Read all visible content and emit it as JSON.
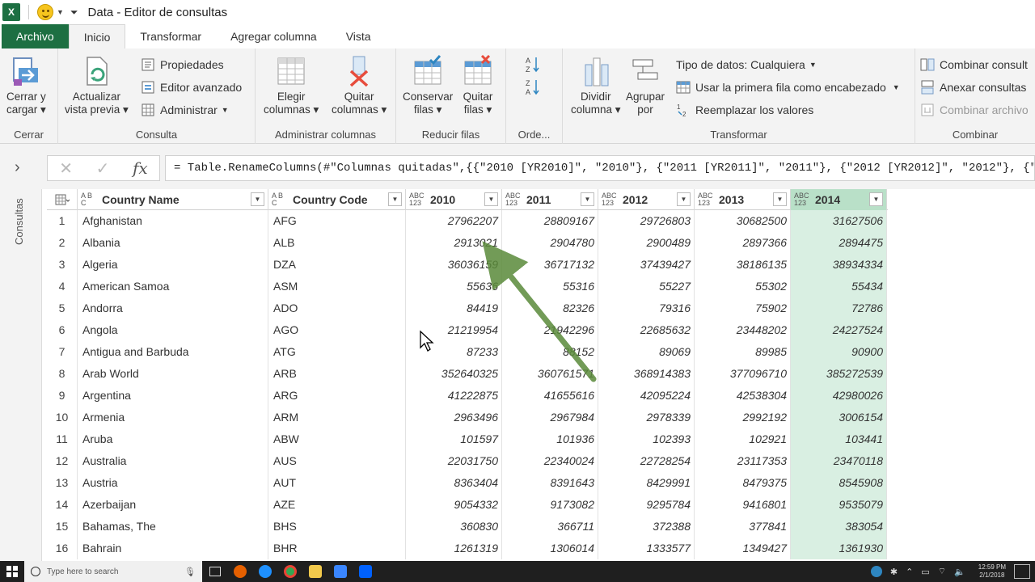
{
  "window": {
    "title": "Data - Editor de consultas"
  },
  "tabs": [
    "Archivo",
    "Inicio",
    "Transformar",
    "Agregar columna",
    "Vista"
  ],
  "ribbon": {
    "cerrar": {
      "btn1": "Cerrar y",
      "btn2": "cargar",
      "label": "Cerrar"
    },
    "consulta": {
      "actualizar1": "Actualizar",
      "actualizar2": "vista previa",
      "propiedades": "Propiedades",
      "editor": "Editor avanzado",
      "administrar": "Administrar",
      "label": "Consulta"
    },
    "columnas": {
      "elegir1": "Elegir",
      "elegir2": "columnas",
      "quitar1": "Quitar",
      "quitar2": "columnas",
      "label": "Administrar columnas"
    },
    "filas": {
      "conservar1": "Conservar",
      "conservar2": "filas",
      "quitar1": "Quitar",
      "quitar2": "filas",
      "label": "Reducir filas"
    },
    "ordenar": {
      "label": "Orde..."
    },
    "transformar": {
      "dividir1": "Dividir",
      "dividir2": "columna",
      "agrupar1": "Agrupar",
      "agrupar2": "por",
      "tipo": "Tipo de datos: Cualquiera",
      "primera": "Usar la primera fila como encabezado",
      "reemplazar": "Reemplazar los valores",
      "label": "Transformar"
    },
    "combinar": {
      "combinar": "Combinar consult",
      "anexar": "Anexar consultas",
      "archivos": "Combinar archivo",
      "label": "Combinar"
    }
  },
  "formula": "= Table.RenameColumns(#\"Columnas quitadas\",{{\"2010 [YR2010]\", \"2010\"}, {\"2011 [YR2011]\", \"2011\"}, {\"2012 [YR2012]\", \"2012\"}, {\"",
  "left_pane": {
    "label": "Consultas"
  },
  "table": {
    "columns": [
      "Country Name",
      "Country Code",
      "2010",
      "2011",
      "2012",
      "2013",
      "2014"
    ],
    "text_type": "A B C",
    "num_type": "ABC 123",
    "rows": [
      [
        "1",
        "Afghanistan",
        "AFG",
        "27962207",
        "28809167",
        "29726803",
        "30682500",
        "31627506"
      ],
      [
        "2",
        "Albania",
        "ALB",
        "2913021",
        "2904780",
        "2900489",
        "2897366",
        "2894475"
      ],
      [
        "3",
        "Algeria",
        "DZA",
        "36036159",
        "36717132",
        "37439427",
        "38186135",
        "38934334"
      ],
      [
        "4",
        "American Samoa",
        "ASM",
        "55636",
        "55316",
        "55227",
        "55302",
        "55434"
      ],
      [
        "5",
        "Andorra",
        "ADO",
        "84419",
        "82326",
        "79316",
        "75902",
        "72786"
      ],
      [
        "6",
        "Angola",
        "AGO",
        "21219954",
        "21942296",
        "22685632",
        "23448202",
        "24227524"
      ],
      [
        "7",
        "Antigua and Barbuda",
        "ATG",
        "87233",
        "88152",
        "89069",
        "89985",
        "90900"
      ],
      [
        "8",
        "Arab World",
        "ARB",
        "352640325",
        "360761571",
        "368914383",
        "377096710",
        "385272539"
      ],
      [
        "9",
        "Argentina",
        "ARG",
        "41222875",
        "41655616",
        "42095224",
        "42538304",
        "42980026"
      ],
      [
        "10",
        "Armenia",
        "ARM",
        "2963496",
        "2967984",
        "2978339",
        "2992192",
        "3006154"
      ],
      [
        "11",
        "Aruba",
        "ABW",
        "101597",
        "101936",
        "102393",
        "102921",
        "103441"
      ],
      [
        "12",
        "Australia",
        "AUS",
        "22031750",
        "22340024",
        "22728254",
        "23117353",
        "23470118"
      ],
      [
        "13",
        "Austria",
        "AUT",
        "8363404",
        "8391643",
        "8429991",
        "8479375",
        "8545908"
      ],
      [
        "14",
        "Azerbaijan",
        "AZE",
        "9054332",
        "9173082",
        "9295784",
        "9416801",
        "9535079"
      ],
      [
        "15",
        "Bahamas, The",
        "BHS",
        "360830",
        "366711",
        "372388",
        "377841",
        "383054"
      ],
      [
        "16",
        "Bahrain",
        "BHR",
        "1261319",
        "1306014",
        "1333577",
        "1349427",
        "1361930"
      ]
    ]
  },
  "taskbar": {
    "search": "Type here to search",
    "time": "12:59 PM",
    "date": "2/1/2018"
  },
  "colors": {
    "excel_green": "#1d6f42",
    "selected_column": "#d9efe2",
    "annotation_arrow": "#5a8a3a"
  }
}
